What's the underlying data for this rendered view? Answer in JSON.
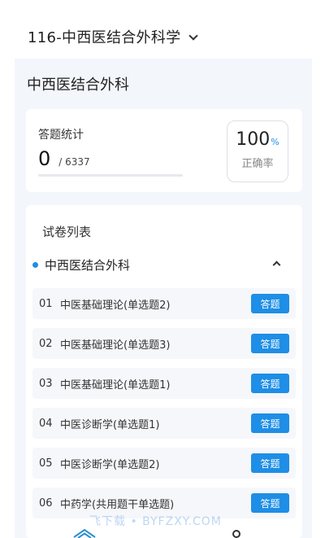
{
  "header": {
    "title": "116-中西医结合外科学"
  },
  "subject_title": "中西医结合外科",
  "stats": {
    "label": "答题统计",
    "answered": "0",
    "total": "/ 6337",
    "progress_fraction": 0,
    "accuracy_value": "100",
    "accuracy_unit": "%",
    "accuracy_label": "正确率"
  },
  "paper_list": {
    "title": "试卷列表",
    "section_name": "中西医结合外科",
    "items": [
      {
        "num": "01",
        "name": "中医基础理论(单选题2)",
        "button": "答题"
      },
      {
        "num": "02",
        "name": "中医基础理论(单选题3)",
        "button": "答题"
      },
      {
        "num": "03",
        "name": "中医基础理论(单选题1)",
        "button": "答题"
      },
      {
        "num": "04",
        "name": "中医诊断学(单选题1)",
        "button": "答题"
      },
      {
        "num": "05",
        "name": "中医诊断学(单选题2)",
        "button": "答题"
      },
      {
        "num": "06",
        "name": "中药学(共用题干单选题)",
        "button": "答题"
      }
    ]
  },
  "watermark": "飞下载 • BYFZXY.COM",
  "colors": {
    "accent": "#1e8ee6",
    "panel_bg": "#f3f6fb"
  },
  "icons": {
    "header_toggle": "chevron-down-icon",
    "section_toggle": "chevron-up-icon"
  }
}
